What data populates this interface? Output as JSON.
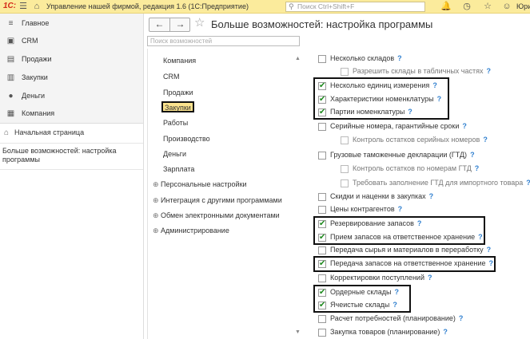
{
  "titlebar": {
    "logo": "1С:",
    "title": "Управление нашей фирмой, редакция 1.6  (1С:Предприятие)",
    "search_placeholder": "Поиск Ctrl+Shift+F",
    "user": "Юри",
    "icons": [
      "menu-icon",
      "bell-icon",
      "history-icon",
      "star-icon"
    ]
  },
  "nav": {
    "sections": [
      {
        "label": "Главное",
        "icon": "menu-lines-icon"
      },
      {
        "label": "CRM",
        "icon": "crm-icon"
      },
      {
        "label": "Продажи",
        "icon": "sales-icon"
      },
      {
        "label": "Закупки",
        "icon": "purchases-icon"
      },
      {
        "label": "Деньги",
        "icon": "money-icon"
      },
      {
        "label": "Компания",
        "icon": "company-icon"
      }
    ],
    "home": "Начальная страница",
    "open_window": "Больше возможностей: настройка программы"
  },
  "header": {
    "back": "←",
    "forward": "→",
    "title": "Больше возможностей: настройка программы"
  },
  "sections_panel": {
    "search_placeholder": "Поиск возможностей",
    "items": [
      "Компания",
      "CRM",
      "Продажи",
      "Закупки",
      "Работы",
      "Производство",
      "Деньги",
      "Зарплата"
    ],
    "groups": [
      "Персональные настройки",
      "Интеграция с другими программами",
      "Обмен электронными документами",
      "Администрирование"
    ]
  },
  "settings": {
    "options": [
      {
        "label": "Несколько складов",
        "checked": false
      },
      {
        "label": "Разрешить склады в табличных частях",
        "checked": false
      },
      {
        "label": "Несколько единиц измерения",
        "checked": true
      },
      {
        "label": "Характеристики номенклатуры",
        "checked": true
      },
      {
        "label": "Партии номенклатуры",
        "checked": true
      },
      {
        "label": "Серийные номера, гарантийные сроки",
        "checked": false
      },
      {
        "label": "Контроль остатков серийных номеров",
        "checked": false
      },
      {
        "label": "Грузовые таможенные декларации (ГТД)",
        "checked": false
      },
      {
        "label": "Контроль остатков по номерам ГТД",
        "checked": false
      },
      {
        "label": "Требовать заполнение ГТД для импортного товара",
        "checked": false
      },
      {
        "label": "Скидки и наценки в закупках",
        "checked": false
      },
      {
        "label": "Цены контрагентов",
        "checked": false
      },
      {
        "label": "Резервирование запасов",
        "checked": true
      },
      {
        "label": "Прием запасов на ответственное хранение",
        "checked": true
      },
      {
        "label": "Передача сырья и материалов в переработку",
        "checked": false
      },
      {
        "label": "Передача запасов на ответственное хранение",
        "checked": true
      },
      {
        "label": "Корректировки поступлений",
        "checked": false
      },
      {
        "label": "Ордерные склады",
        "checked": true
      },
      {
        "label": "Ячеистые склады",
        "checked": true
      },
      {
        "label": "Расчет потребностей (планирование)",
        "checked": false
      },
      {
        "label": "Закупка товаров (планирование)",
        "checked": false
      }
    ],
    "help_mark": "?"
  }
}
